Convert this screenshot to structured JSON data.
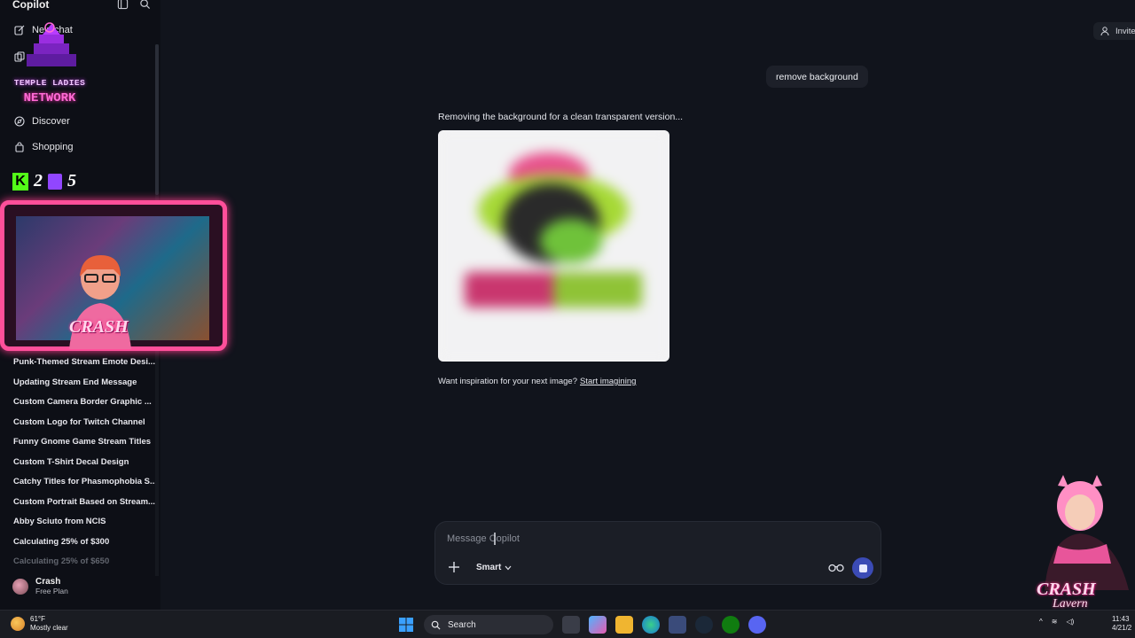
{
  "sidebar": {
    "title": "Copilot",
    "new_chat": "New chat",
    "nav": [
      {
        "label": "Discover"
      },
      {
        "label": "Shopping"
      }
    ],
    "history": [
      "Punk-Themed Stream Emote Desi...",
      "Updating Stream End Message",
      "Custom Camera Border Graphic ...",
      "Custom Logo for Twitch Channel",
      "Funny Gnome Game Stream Titles",
      "Custom T-Shirt Decal Design",
      "Catchy Titles for Phasmophobia S...",
      "Custom Portrait Based on Stream...",
      "Abby Sciuto from NCIS",
      "Calculating 25% of $300",
      "Calculating 25% of $650"
    ],
    "user": {
      "name": "Crash",
      "plan": "Free Plan"
    }
  },
  "header": {
    "invite": "Invite"
  },
  "chat": {
    "user_message": "remove background",
    "assistant_text": "Removing the background for a clean transparent version...",
    "inspire_text": "Want inspiration for your next image?",
    "inspire_link": "Start imagining"
  },
  "composer": {
    "placeholder": "Message Copilot",
    "mode": "Smart"
  },
  "taskbar": {
    "temp": "61°F",
    "condition": "Mostly clear",
    "search": "Search",
    "time": "11:43",
    "date": "4/21/2"
  },
  "overlay": {
    "logo_line1": "TEMPLE LADIES",
    "logo_line2": "NETWORK",
    "kick_count": "2",
    "twitch_count": "5",
    "brand": "CRASH",
    "brand_script": "Lavern"
  },
  "colors": {
    "background": "#11141c",
    "sidebar": "#0d0f16",
    "accent_send": "#3b4bb5",
    "overlay_pink": "#ff4f9a"
  }
}
